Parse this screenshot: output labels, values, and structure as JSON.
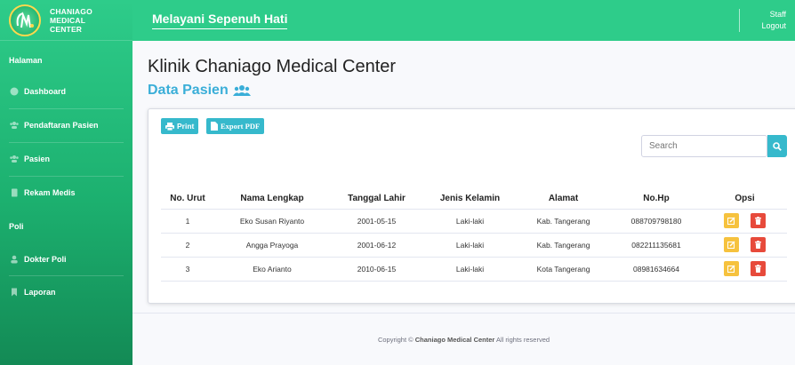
{
  "sidebar": {
    "brand_lines": [
      "CHANIAGO",
      "MEDICAL",
      "CENTER"
    ],
    "sections": [
      {
        "label": "Halaman"
      },
      {
        "label": "Poli"
      }
    ],
    "items": [
      {
        "label": "Dashboard",
        "icon": "palette-icon"
      },
      {
        "label": "Pendaftaran Pasien",
        "icon": "users-icon"
      },
      {
        "label": "Pasien",
        "icon": "users-icon"
      },
      {
        "label": "Rekam Medis",
        "icon": "file-icon"
      },
      {
        "label": "Dokter Poli",
        "icon": "user-icon"
      },
      {
        "label": "Laporan",
        "icon": "bookmark-icon"
      }
    ]
  },
  "topbar": {
    "tagline": "Melayani Sepenuh Hati",
    "user": "Staff",
    "logout": "Logout"
  },
  "main": {
    "title": "Klinik Chaniago Medical Center",
    "subtitle": "Data Pasien",
    "print_label": "Print",
    "export_label": "Export PDF",
    "search_placeholder": "Search",
    "columns": [
      "No. Urut",
      "Nama Lengkap",
      "Tanggal Lahir",
      "Jenis Kelamin",
      "Alamat",
      "No.Hp",
      "Opsi"
    ],
    "rows": [
      {
        "no": "1",
        "nama": "Eko Susan Riyanto",
        "tgl": "2001-05-15",
        "jk": "Laki-laki",
        "alamat": "Kab. Tangerang",
        "hp": "088709798180"
      },
      {
        "no": "2",
        "nama": "Angga Prayoga",
        "tgl": "2001-06-12",
        "jk": "Laki-laki",
        "alamat": "Kab. Tangerang",
        "hp": "082211135681"
      },
      {
        "no": "3",
        "nama": "Eko Arianto",
        "tgl": "2010-06-15",
        "jk": "Laki-laki",
        "alamat": "Kota Tangerang",
        "hp": "08981634664"
      }
    ]
  },
  "footer": {
    "prefix": "Copyright © ",
    "brand": "Chaniago Medical Center",
    "suffix": " All rights reserved"
  },
  "colors": {
    "sidebar_green": "#2ecc8a",
    "info": "#36b9cc",
    "warning": "#f6c23e",
    "danger": "#e74a3b"
  }
}
